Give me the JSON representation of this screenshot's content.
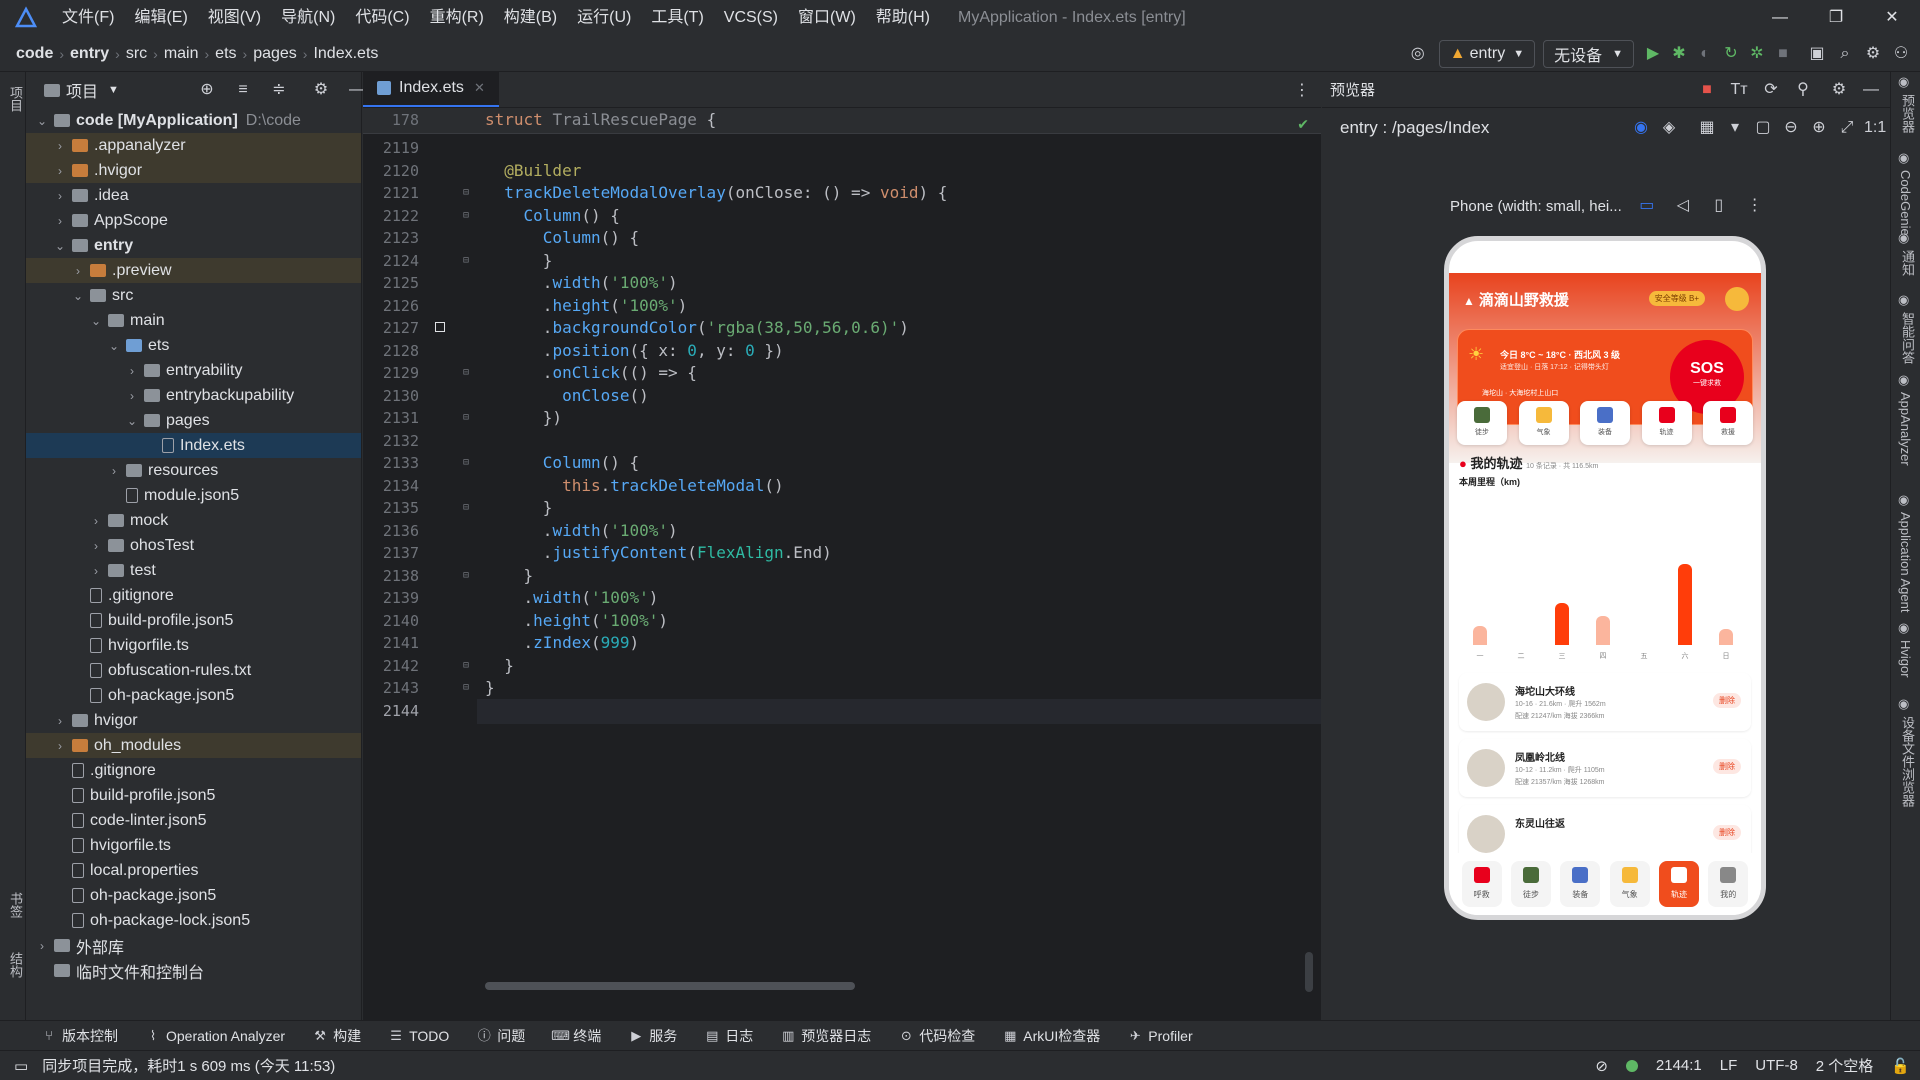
{
  "app": {
    "window_title": "MyApplication - Index.ets [entry]",
    "menu": [
      "文件(F)",
      "编辑(E)",
      "视图(V)",
      "导航(N)",
      "代码(C)",
      "重构(R)",
      "构建(B)",
      "运行(U)",
      "工具(T)",
      "VCS(S)",
      "窗口(W)",
      "帮助(H)"
    ]
  },
  "breadcrumb": [
    "code",
    "entry",
    "src",
    "main",
    "ets",
    "pages",
    "Index.ets"
  ],
  "toolbar": {
    "module": "entry",
    "device": "无设备"
  },
  "project": {
    "title": "项目",
    "tree": [
      {
        "label": "code [MyApplication]",
        "extra": "D:\\code",
        "depth": 0,
        "arrow": "open",
        "icon": "dir",
        "bold": true
      },
      {
        "label": ".appanalyzer",
        "depth": 1,
        "arrow": "closed",
        "icon": "org",
        "hl": true
      },
      {
        "label": ".hvigor",
        "depth": 1,
        "arrow": "closed",
        "icon": "org",
        "hl": true
      },
      {
        "label": ".idea",
        "depth": 1,
        "arrow": "closed",
        "icon": "dir"
      },
      {
        "label": "AppScope",
        "depth": 1,
        "arrow": "closed",
        "icon": "dir"
      },
      {
        "label": "entry",
        "depth": 1,
        "arrow": "open",
        "icon": "dir",
        "bold": true
      },
      {
        "label": ".preview",
        "depth": 2,
        "arrow": "closed",
        "icon": "org",
        "hl": true
      },
      {
        "label": "src",
        "depth": 2,
        "arrow": "open",
        "icon": "dir"
      },
      {
        "label": "main",
        "depth": 3,
        "arrow": "open",
        "icon": "dir"
      },
      {
        "label": "ets",
        "depth": 4,
        "arrow": "open",
        "icon": "blue"
      },
      {
        "label": "entryability",
        "depth": 5,
        "arrow": "closed",
        "icon": "dir"
      },
      {
        "label": "entrybackupability",
        "depth": 5,
        "arrow": "closed",
        "icon": "dir"
      },
      {
        "label": "pages",
        "depth": 5,
        "arrow": "open",
        "icon": "dir"
      },
      {
        "label": "Index.ets",
        "depth": 6,
        "arrow": "none",
        "icon": "file",
        "sel": true
      },
      {
        "label": "resources",
        "depth": 4,
        "arrow": "closed",
        "icon": "dir"
      },
      {
        "label": "module.json5",
        "depth": 4,
        "arrow": "none",
        "icon": "file"
      },
      {
        "label": "mock",
        "depth": 3,
        "arrow": "closed",
        "icon": "dir"
      },
      {
        "label": "ohosTest",
        "depth": 3,
        "arrow": "closed",
        "icon": "dir"
      },
      {
        "label": "test",
        "depth": 3,
        "arrow": "closed",
        "icon": "dir"
      },
      {
        "label": ".gitignore",
        "depth": 2,
        "arrow": "none",
        "icon": "file"
      },
      {
        "label": "build-profile.json5",
        "depth": 2,
        "arrow": "none",
        "icon": "file"
      },
      {
        "label": "hvigorfile.ts",
        "depth": 2,
        "arrow": "none",
        "icon": "file"
      },
      {
        "label": "obfuscation-rules.txt",
        "depth": 2,
        "arrow": "none",
        "icon": "file"
      },
      {
        "label": "oh-package.json5",
        "depth": 2,
        "arrow": "none",
        "icon": "file"
      },
      {
        "label": "hvigor",
        "depth": 1,
        "arrow": "closed",
        "icon": "dir"
      },
      {
        "label": "oh_modules",
        "depth": 1,
        "arrow": "closed",
        "icon": "org",
        "hl": true
      },
      {
        "label": ".gitignore",
        "depth": 1,
        "arrow": "none",
        "icon": "file"
      },
      {
        "label": "build-profile.json5",
        "depth": 1,
        "arrow": "none",
        "icon": "file"
      },
      {
        "label": "code-linter.json5",
        "depth": 1,
        "arrow": "none",
        "icon": "file"
      },
      {
        "label": "hvigorfile.ts",
        "depth": 1,
        "arrow": "none",
        "icon": "file"
      },
      {
        "label": "local.properties",
        "depth": 1,
        "arrow": "none",
        "icon": "file"
      },
      {
        "label": "oh-package.json5",
        "depth": 1,
        "arrow": "none",
        "icon": "file"
      },
      {
        "label": "oh-package-lock.json5",
        "depth": 1,
        "arrow": "none",
        "icon": "file"
      },
      {
        "label": "外部库",
        "depth": 0,
        "arrow": "closed",
        "icon": "dir"
      },
      {
        "label": "临时文件和控制台",
        "depth": 0,
        "arrow": "none",
        "icon": "dir"
      }
    ]
  },
  "editor": {
    "tab": "Index.ets",
    "sticky_line": "178",
    "sticky_code": "struct TrailRescuePage {",
    "lines": [
      {
        "n": "2119",
        "html": ""
      },
      {
        "n": "2120",
        "html": "  <span class='an'>@Builder</span>"
      },
      {
        "n": "2121",
        "html": "  <span class='fn'>trackDeleteModalOverlay</span>(onClose: () => <span class='kw'>void</span>) {"
      },
      {
        "n": "2122",
        "html": "    <span class='fn'>Column</span>() {"
      },
      {
        "n": "2123",
        "html": "      <span class='fn'>Column</span>() {"
      },
      {
        "n": "2124",
        "html": "      }"
      },
      {
        "n": "2125",
        "html": "      .<span class='fn'>width</span>(<span class='st'>'100%'</span>)"
      },
      {
        "n": "2126",
        "html": "      .<span class='fn'>height</span>(<span class='st'>'100%'</span>)"
      },
      {
        "n": "2127",
        "html": "      .<span class='fn'>backgroundColor</span>(<span class='st'>'rgba(38,50,56,0.6)'</span>)"
      },
      {
        "n": "2128",
        "html": "      .<span class='fn'>position</span>({ x: <span class='nm'>0</span>, y: <span class='nm'>0</span> })"
      },
      {
        "n": "2129",
        "html": "      .<span class='fn'>onClick</span>(() => {"
      },
      {
        "n": "2130",
        "html": "        <span class='fn'>onClose</span>()"
      },
      {
        "n": "2131",
        "html": "      })"
      },
      {
        "n": "2132",
        "html": ""
      },
      {
        "n": "2133",
        "html": "      <span class='fn'>Column</span>() {"
      },
      {
        "n": "2134",
        "html": "        <span class='kw'>this</span>.<span class='fn'>trackDeleteModal</span>()"
      },
      {
        "n": "2135",
        "html": "      }"
      },
      {
        "n": "2136",
        "html": "      .<span class='fn'>width</span>(<span class='st'>'100%'</span>)"
      },
      {
        "n": "2137",
        "html": "      .<span class='fn'>justifyContent</span>(<span class='ty'>FlexAlign</span>.End)"
      },
      {
        "n": "2138",
        "html": "    }"
      },
      {
        "n": "2139",
        "html": "    .<span class='fn'>width</span>(<span class='st'>'100%'</span>)"
      },
      {
        "n": "2140",
        "html": "    .<span class='fn'>height</span>(<span class='st'>'100%'</span>)"
      },
      {
        "n": "2141",
        "html": "    .<span class='fn'>zIndex</span>(<span class='nm'>999</span>)"
      },
      {
        "n": "2142",
        "html": "  }"
      },
      {
        "n": "2143",
        "html": "}"
      },
      {
        "n": "2144",
        "html": ""
      }
    ]
  },
  "preview": {
    "title": "预览器",
    "route": "entry : /pages/Index",
    "device": "Phone (width: small, hei...",
    "app": {
      "title": "滴滴山野救援",
      "badge": "安全等级 B+",
      "weather1": "今日 8°C ~ 18°C · 西北风 3 级",
      "weather2": "适宜登山 · 日落 17:12 · 记得带头灯",
      "location": "海坨山 · 大海坨村上山口",
      "sos": "SOS",
      "sos_sub": "一键求救",
      "quick": [
        "徒步",
        "气象",
        "装备",
        "轨迹",
        "救援"
      ],
      "track_section": "我的轨迹",
      "track_meta": "10 条记录 · 共 116.5km",
      "week_title": "本周里程（km)",
      "week_labels": [
        "一",
        "二",
        "三",
        "四",
        "五",
        "六",
        "日"
      ],
      "tracks": [
        {
          "name": "海坨山大环线",
          "meta": "10-16 · 21.6km · 爬升 1562m",
          "meta2": "配速 21247/km  海拔 2366km",
          "del": "删除"
        },
        {
          "name": "凤凰岭北线",
          "meta": "10-12 · 11.2km · 爬升 1105m",
          "meta2": "配速 21357/km  海拔 1268km",
          "del": "删除"
        },
        {
          "name": "东灵山往返",
          "meta": "",
          "meta2": "",
          "del": "删除"
        }
      ],
      "nav": [
        "呼救",
        "徒步",
        "装备",
        "气象",
        "轨迹",
        "我的"
      ]
    }
  },
  "chart_data": {
    "type": "bar",
    "title": "本周里程（km)",
    "categories": [
      "一",
      "二",
      "三",
      "四",
      "五",
      "六",
      "日"
    ],
    "values": [
      3,
      0,
      6.5,
      4.5,
      0,
      12.5,
      2.5
    ]
  },
  "right_strip": [
    "预览器",
    "CodeGenie",
    "通知",
    "智能问答",
    "AppAnalyzer",
    "Application Agent",
    "Hvigor",
    "设备文件浏览器"
  ],
  "left_strip": [
    "项目",
    "书签",
    "结构"
  ],
  "bottom_tools": [
    "版本控制",
    "Operation Analyzer",
    "构建",
    "TODO",
    "问题",
    "终端",
    "服务",
    "日志",
    "预览器日志",
    "代码检查",
    "ArkUI检查器",
    "Profiler"
  ],
  "status": {
    "message": "同步项目完成，耗时1 s 609 ms (今天 11:53)",
    "position": "2144:1",
    "eol": "LF",
    "encoding": "UTF-8",
    "indent": "2 个空格"
  },
  "colors": {
    "accent": "#3574f0",
    "run": "#5fb865",
    "brand": "#e8431e"
  }
}
